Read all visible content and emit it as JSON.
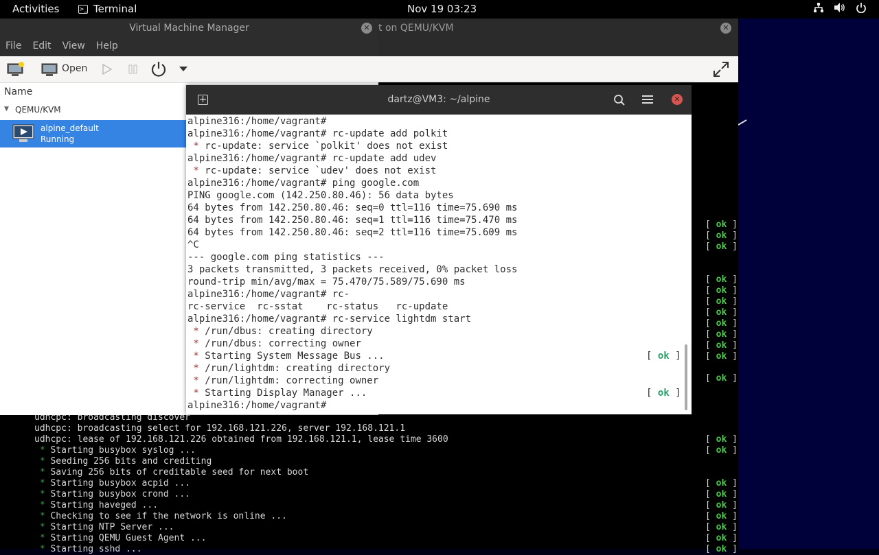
{
  "topbar": {
    "activities": "Activities",
    "app_name": "Terminal",
    "clock": "Nov 19  03:23"
  },
  "viewer": {
    "title_fragment": "t on QEMU/KVM"
  },
  "vmm": {
    "title": "Virtual Machine Manager",
    "menu": [
      "File",
      "Edit",
      "View",
      "Help"
    ],
    "open_label": "Open",
    "column_name": "Name",
    "group": "QEMU/KVM",
    "vm_name": "alpine_default",
    "vm_state": "Running"
  },
  "terminal": {
    "title": "dartz@VM3: ~/alpine",
    "lines": [
      {
        "t": "alpine316:/home/vagrant#"
      },
      {
        "t": "alpine316:/home/vagrant# rc-update add polkit"
      },
      {
        "star": " * ",
        "t": "rc-update: service `polkit' does not exist"
      },
      {
        "t": "alpine316:/home/vagrant# rc-update add udev"
      },
      {
        "star": " * ",
        "t": "rc-update: service `udev' does not exist"
      },
      {
        "t": "alpine316:/home/vagrant# ping google.com"
      },
      {
        "t": "PING google.com (142.250.80.46): 56 data bytes"
      },
      {
        "t": "64 bytes from 142.250.80.46: seq=0 ttl=116 time=75.690 ms"
      },
      {
        "t": "64 bytes from 142.250.80.46: seq=1 ttl=116 time=75.470 ms"
      },
      {
        "t": "64 bytes from 142.250.80.46: seq=2 ttl=116 time=75.609 ms"
      },
      {
        "t": "^C"
      },
      {
        "t": "--- google.com ping statistics ---"
      },
      {
        "t": "3 packets transmitted, 3 packets received, 0% packet loss"
      },
      {
        "t": "round-trip min/avg/max = 75.470/75.589/75.690 ms"
      },
      {
        "t": "alpine316:/home/vagrant# rc-"
      },
      {
        "t": "rc-service  rc-sstat    rc-status   rc-update"
      },
      {
        "t": "alpine316:/home/vagrant# rc-service lightdm start"
      },
      {
        "star": " * ",
        "t": "/run/dbus: creating directory"
      },
      {
        "star": " * ",
        "t": "/run/dbus: correcting owner"
      },
      {
        "star": " * ",
        "t": "Starting System Message Bus ...",
        "ok": true
      },
      {
        "star": " * ",
        "t": "/run/lightdm: creating directory"
      },
      {
        "star": " * ",
        "t": "/run/lightdm: correcting owner"
      },
      {
        "star": " * ",
        "t": "Starting Display Manager ...",
        "ok": true
      },
      {
        "t": "alpine316:/home/vagrant#"
      }
    ],
    "ok_label": "ok"
  },
  "console": {
    "ok_label": "ok",
    "right_oks_upper": 13,
    "lines": [
      {
        "t": "udhcpc: broadcasting discover"
      },
      {
        "t": "udhcpc: broadcasting select for 192.168.121.226, server 192.168.121.1"
      },
      {
        "t": "udhcpc: lease of 192.168.121.226 obtained from 192.168.121.1, lease time 3600",
        "ok": true
      },
      {
        "star": " * ",
        "t": "Starting busybox syslog ...",
        "ok": true
      },
      {
        "star": " * ",
        "t": "Seeding 256 bits and crediting"
      },
      {
        "star": " * ",
        "t": "Saving 256 bits of creditable seed for next boot"
      },
      {
        "star": " * ",
        "t": "Starting busybox acpid ...",
        "ok": true
      },
      {
        "star": " * ",
        "t": "Starting busybox crond ...",
        "ok": true
      },
      {
        "star": " * ",
        "t": "Starting haveged ...",
        "ok": true
      },
      {
        "star": " * ",
        "t": "Checking to see if the network is online ...",
        "ok": true
      },
      {
        "star": " * ",
        "t": "Starting NTP Server ...",
        "ok": true
      },
      {
        "star": " * ",
        "t": "Starting QEMU Guest Agent ...",
        "ok": true
      },
      {
        "star": " * ",
        "t": "Starting sshd ...",
        "ok": true
      }
    ]
  }
}
